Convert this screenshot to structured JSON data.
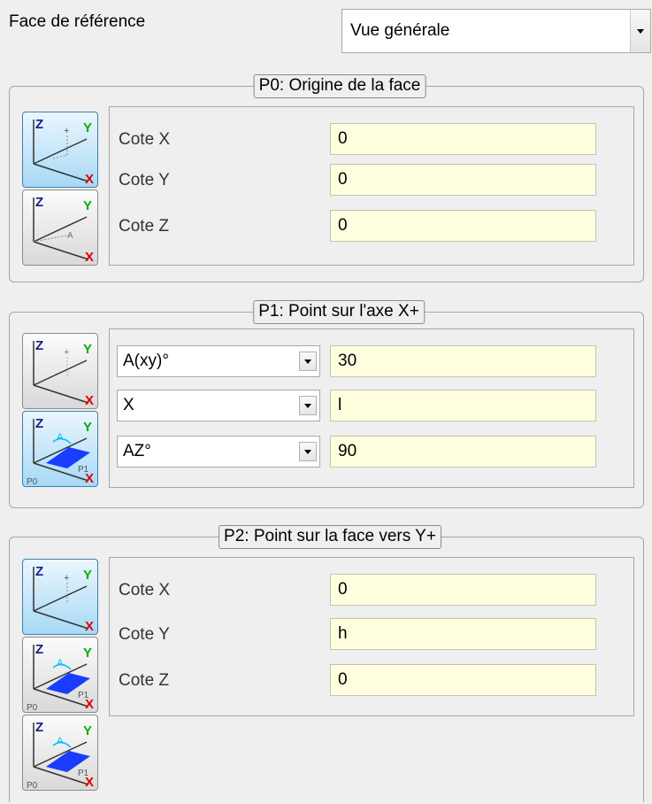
{
  "reference_face": {
    "label": "Face de référence",
    "selected": "Vue générale"
  },
  "p0": {
    "title": "P0: Origine de la face",
    "fields": [
      {
        "label": "Cote X",
        "value": "0"
      },
      {
        "label": "Cote Y",
        "value": "0"
      },
      {
        "label": "Cote Z",
        "value": "0"
      }
    ]
  },
  "p1": {
    "title": "P1: Point sur l'axe X+",
    "rows": [
      {
        "mode": "A(xy)°",
        "value": "30"
      },
      {
        "mode": "X",
        "value": "l"
      },
      {
        "mode": "AZ°",
        "value": "90"
      }
    ]
  },
  "p2": {
    "title": "P2: Point sur la face vers Y+",
    "fields": [
      {
        "label": "Cote X",
        "value": "0"
      },
      {
        "label": "Cote Y",
        "value": "h"
      },
      {
        "label": "Cote Z",
        "value": "0"
      }
    ]
  },
  "axis_glyphs": {
    "z": "Z",
    "y": "Y",
    "x": "X",
    "p0": "P0",
    "p1": "P1",
    "a": "A"
  },
  "colors": {
    "input_bg": "#ffffe0",
    "active_button": "#a7d9f5",
    "axis_y": "#00b000",
    "axis_x": "#e00000",
    "plane": "#1a3cff"
  }
}
